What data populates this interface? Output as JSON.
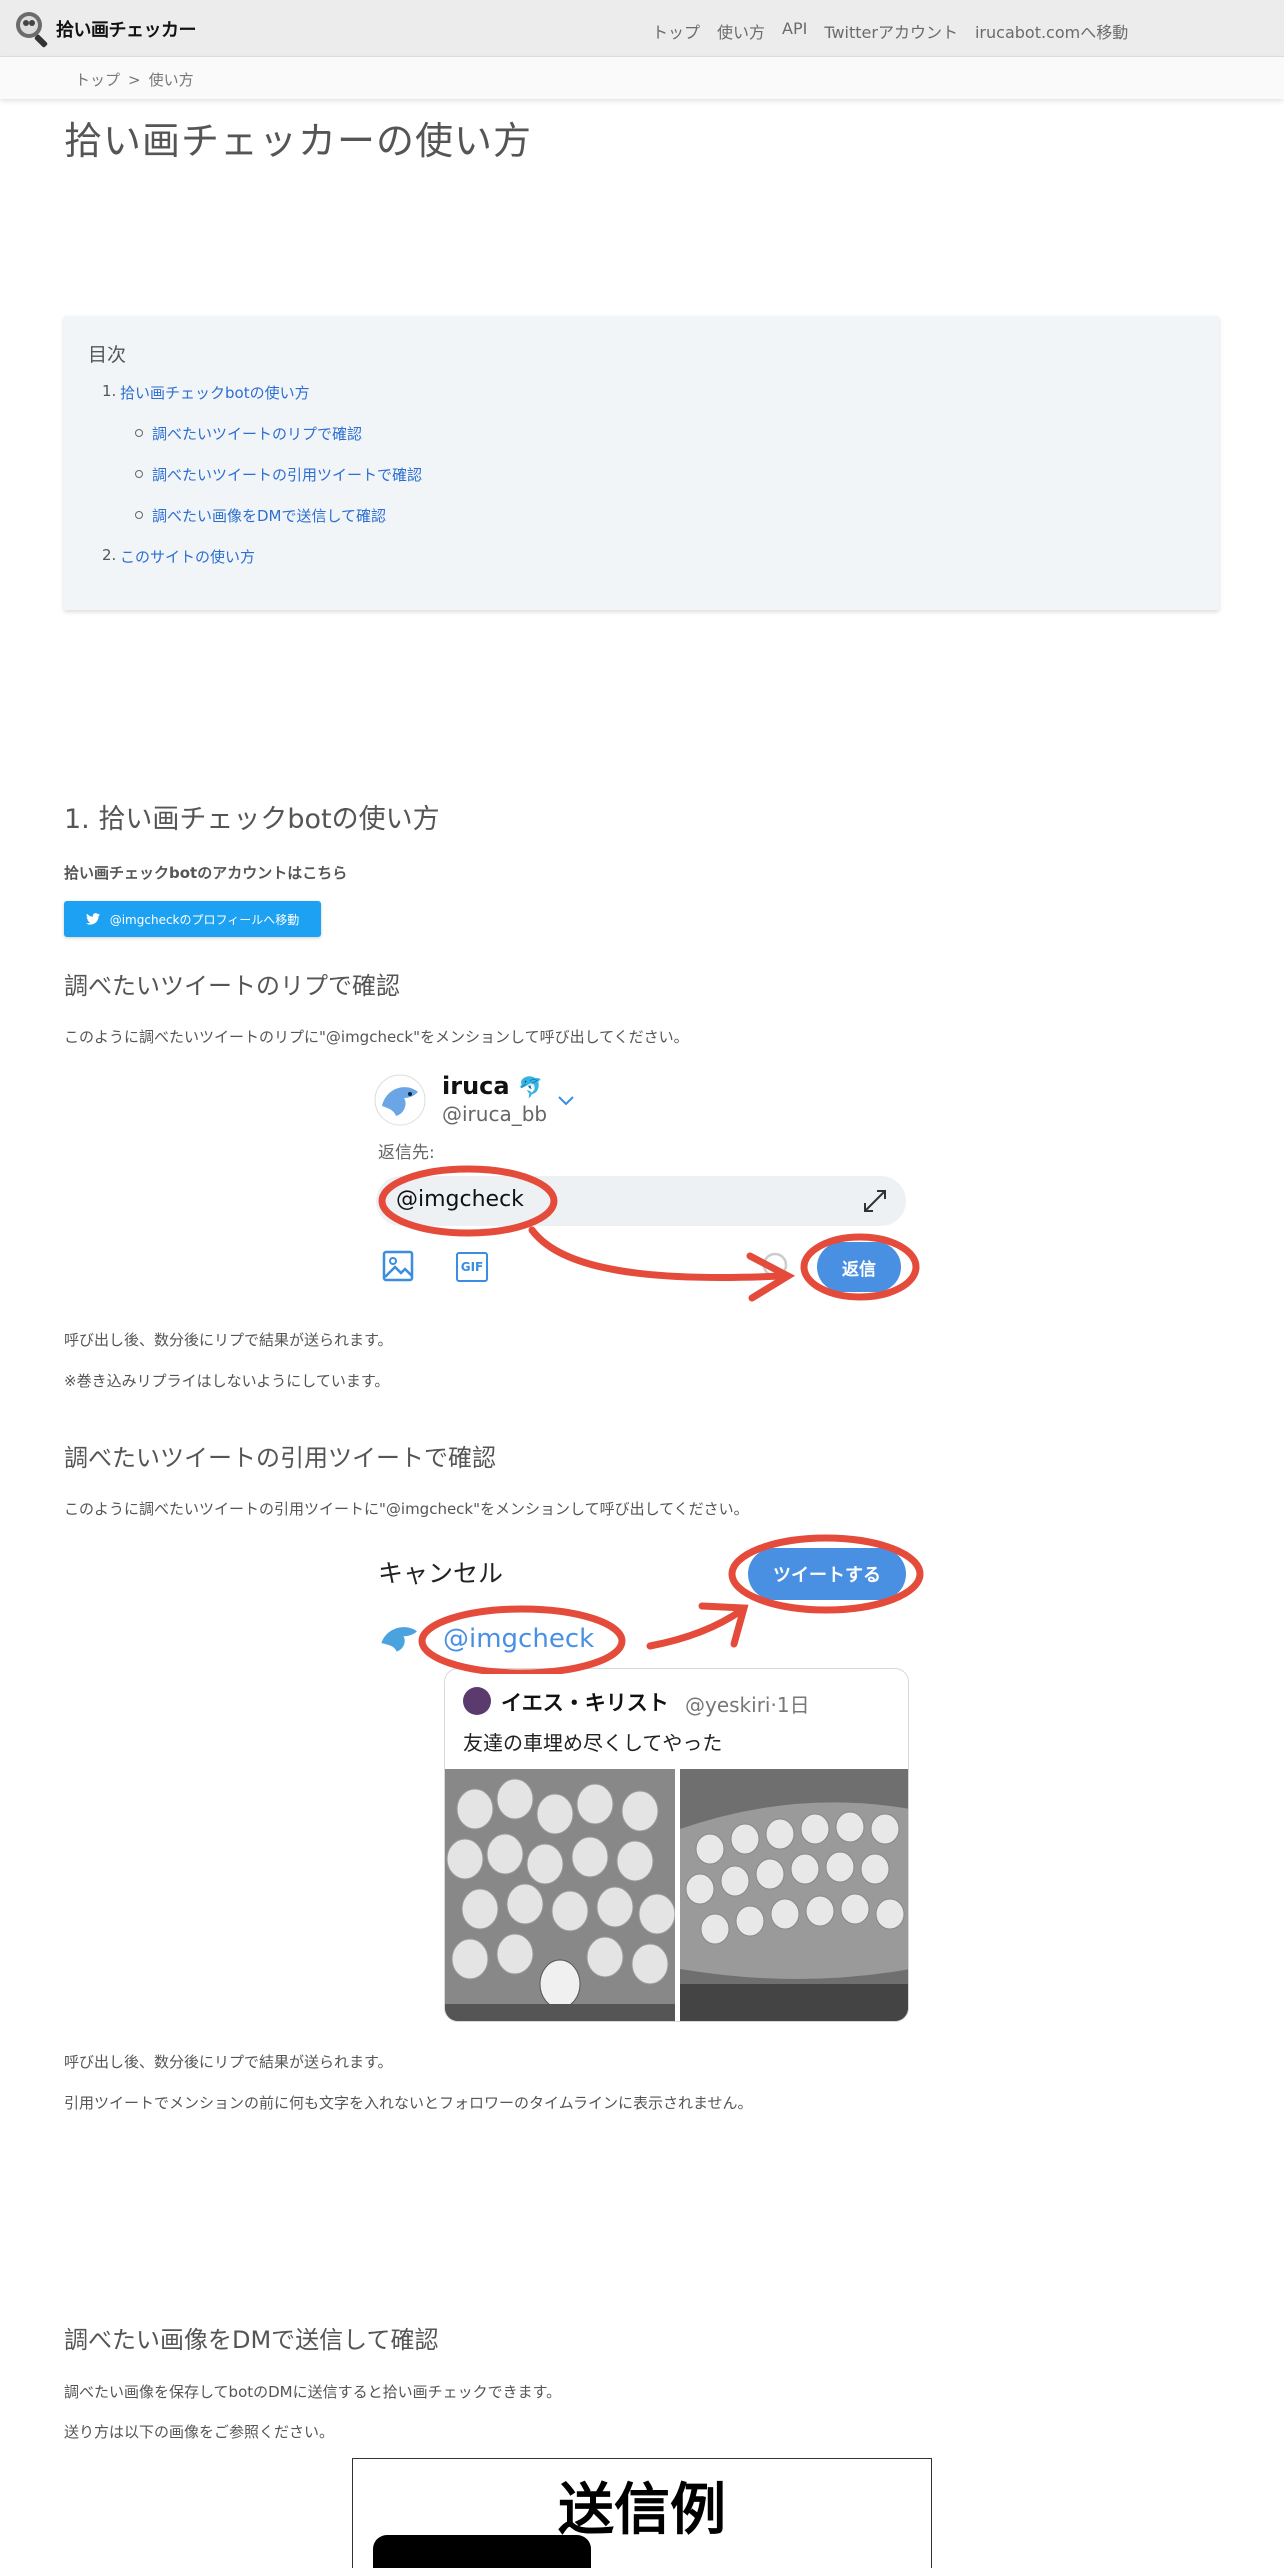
{
  "header": {
    "logo_text": "拾い画チェッカー",
    "nav": [
      "トップ",
      "使い方",
      "API",
      "Twitterアカウント",
      "irucabot.comへ移動"
    ]
  },
  "breadcrumb": {
    "items": [
      "トップ",
      "使い方"
    ],
    "separator": ">"
  },
  "page_title": "拾い画チェッカーの使い方",
  "toc": {
    "title": "目次",
    "items": [
      {
        "num": "1.",
        "label": "拾い画チェックbotの使い方"
      },
      {
        "label": "調べたいツイートのリプで確認"
      },
      {
        "label": "調べたいツイートの引用ツイートで確認"
      },
      {
        "label": "調べたい画像をDMで送信して確認"
      },
      {
        "num": "2.",
        "label": "このサイトの使い方"
      }
    ]
  },
  "section1": {
    "heading_num": "1.",
    "heading": "拾い画チェックbotの使い方",
    "account_note": "拾い画チェックbotのアカウントはこちら",
    "profile_button": "@imgcheckのプロフィールへ移動"
  },
  "reply_section": {
    "heading": "調べたいツイートのリプで確認",
    "intro": "このように調べたいツイートのリプに\"@imgcheck\"をメンションして呼び出してください。",
    "screenshot": {
      "user_name": "iruca",
      "user_handle": "@iruca_bb",
      "reply_to_label": "返信先:",
      "mention": "@imgcheck",
      "gif_label": "GIF",
      "reply_button": "返信"
    },
    "note1": "呼び出し後、数分後にリプで結果が送られます。",
    "note2": "※巻き込みリプライはしないようにしています。"
  },
  "quote_section": {
    "heading": "調べたいツイートの引用ツイートで確認",
    "intro": "このように調べたいツイートの引用ツイートに\"@imgcheck\"をメンションして呼び出してください。",
    "screenshot": {
      "cancel": "キャンセル",
      "tweet_button": "ツイートする",
      "mention": "@imgcheck",
      "quoted_name": "イエス・キリスト",
      "quoted_handle": "@yeskiri",
      "quoted_time": "·1日",
      "quoted_text": "友達の車埋め尽くしてやった"
    },
    "note1": "呼び出し後、数分後にリプで結果が送られます。",
    "note2": "引用ツイートでメンションの前に何も文字を入れないとフォロワーのタイムラインに表示されません。"
  },
  "dm_section": {
    "heading": "調べたい画像をDMで送信して確認",
    "text1": "調べたい画像を保存してbotのDMに送信すると拾い画チェックできます。",
    "text2": "送り方は以下の画像をご参照ください。",
    "example_title": "送信例"
  },
  "colors": {
    "link": "#2c6fd1",
    "twitter_blue": "#1da1f2",
    "annotation_red": "#e54b3b",
    "toc_bg": "#f2f5f8"
  }
}
